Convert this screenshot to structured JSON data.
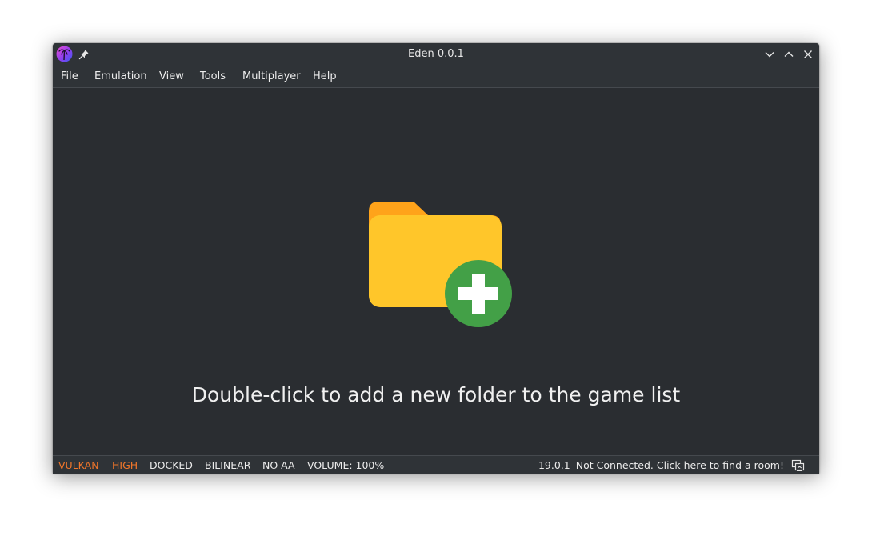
{
  "window": {
    "title": "Eden 0.0.1"
  },
  "menu": {
    "items": [
      "File",
      "Emulation",
      "View",
      "Tools",
      "Multiplayer",
      "Help"
    ]
  },
  "content": {
    "empty_message": "Double-click to add a new folder to the game list"
  },
  "statusbar": {
    "renderer": "VULKAN",
    "accuracy": "HIGH",
    "dock_mode": "DOCKED",
    "filter": "BILINEAR",
    "anti_aliasing": "NO AA",
    "volume": "VOLUME: 100%",
    "version": "19.0.1",
    "network_status": "Not Connected. Click here to find a room!"
  },
  "colors": {
    "window_bg": "#2a2d31",
    "bar_bg": "#2f3337",
    "status_accent": "#f0762a",
    "folder_back": "#ffa31a",
    "folder_front": "#ffc62a",
    "plus_green": "#43a047"
  },
  "icons": {
    "app": "palm-tree-logo-icon",
    "pin": "pin-icon",
    "minimize": "chevron-down-icon",
    "maximize": "chevron-up-icon",
    "close": "close-icon",
    "add_folder": "folder-add-icon",
    "network": "network-icon"
  }
}
